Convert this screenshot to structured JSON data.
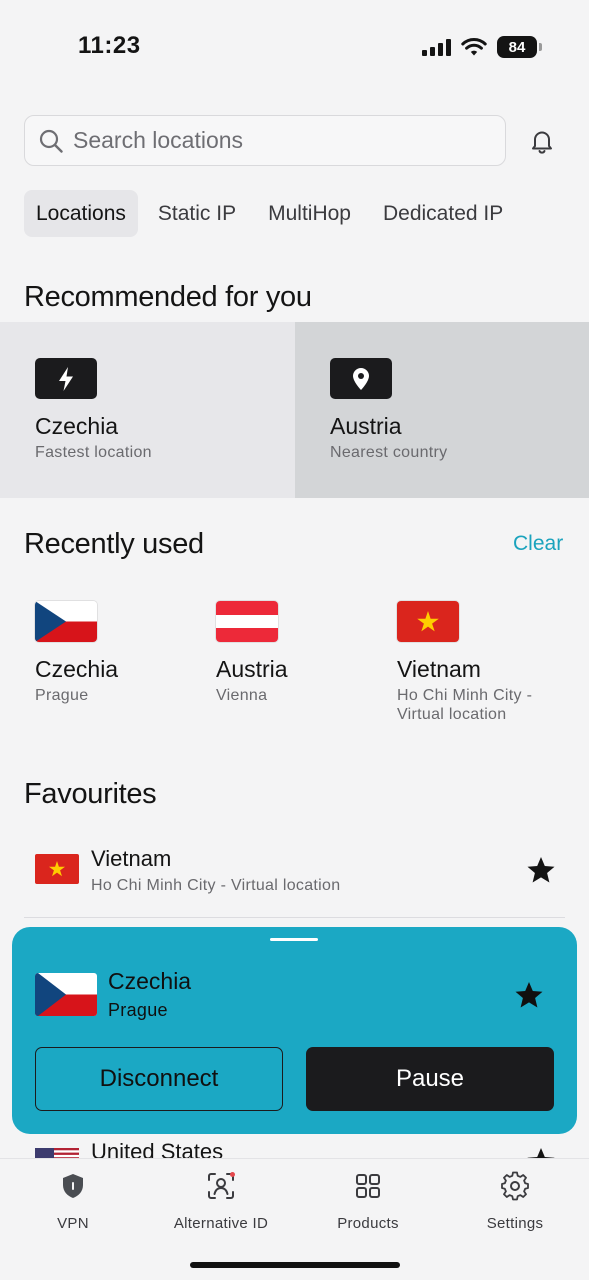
{
  "status_bar": {
    "time": "11:23",
    "battery": "84"
  },
  "search": {
    "placeholder": "Search locations",
    "value": ""
  },
  "tabs": [
    {
      "label": "Locations",
      "active": true
    },
    {
      "label": "Static IP"
    },
    {
      "label": "MultiHop"
    },
    {
      "label": "Dedicated IP"
    }
  ],
  "recommended": {
    "title": "Recommended for you",
    "cards": [
      {
        "name": "Czechia",
        "subtitle": "Fastest location",
        "icon": "bolt-icon"
      },
      {
        "name": "Austria",
        "subtitle": "Nearest country",
        "icon": "location-pin-icon"
      }
    ]
  },
  "recently_used": {
    "title": "Recently used",
    "clear_label": "Clear",
    "items": [
      {
        "name": "Czechia",
        "subtitle": "Prague",
        "flag": "czechia-flag"
      },
      {
        "name": "Austria",
        "subtitle": "Vienna",
        "flag": "austria-flag"
      },
      {
        "name": "Vietnam",
        "subtitle": "Ho Chi Minh City -",
        "subtitle2": "Virtual location",
        "flag": "vietnam-flag"
      }
    ]
  },
  "favourites": {
    "title": "Favourites",
    "items": [
      {
        "name": "Vietnam",
        "subtitle": "Ho Chi Minh City - Virtual location",
        "flag": "vietnam-flag",
        "starred": true
      },
      {
        "name": "United States",
        "flag": "us-flag",
        "starred": true
      }
    ]
  },
  "connection": {
    "name": "Czechia",
    "subtitle": "Prague",
    "flag": "czechia-flag",
    "starred": true,
    "disconnect_label": "Disconnect",
    "pause_label": "Pause"
  },
  "bottom_nav": [
    {
      "label": "VPN",
      "icon": "shield-icon",
      "active": true
    },
    {
      "label": "Alternative ID",
      "icon": "alternative-id-icon",
      "badge": true
    },
    {
      "label": "Products",
      "icon": "grid-icon"
    },
    {
      "label": "Settings",
      "icon": "gear-icon"
    }
  ],
  "colors": {
    "accent": "#1ba8c4",
    "link": "#1ba3bd",
    "dark": "#1b1b1d",
    "background": "#f4f4f5"
  }
}
